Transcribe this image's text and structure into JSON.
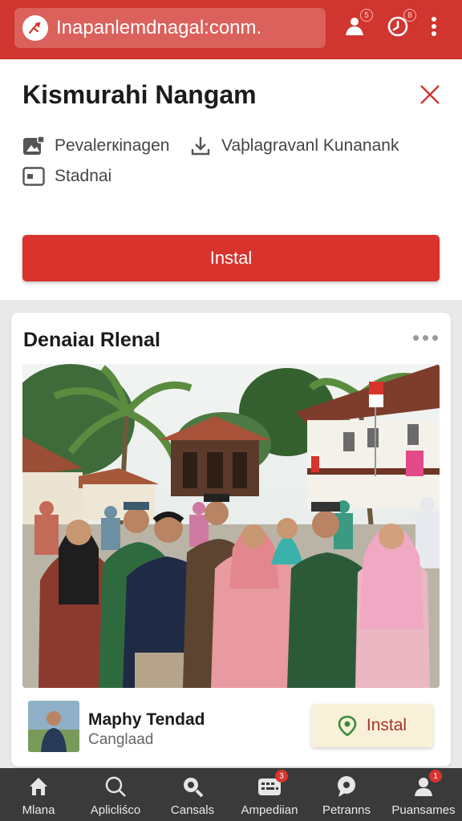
{
  "browser": {
    "url": "Inapanlemdnagal:conm.",
    "badges": {
      "downloads": "5",
      "history": "8"
    }
  },
  "app": {
    "title": "Kismurahi Nangam",
    "meta": [
      {
        "icon": "image-gallery-icon",
        "label": "Pevalerкinagen"
      },
      {
        "icon": "download-icon",
        "label": "Vaþlagravanl Kunanank"
      },
      {
        "icon": "screen-icon",
        "label": "Stadnai"
      }
    ],
    "install_label": "Instal"
  },
  "post": {
    "title": "Denaiaı Rlenal",
    "author_name": "Maphy Tendad",
    "author_sub": "Canglaad",
    "install_label": "Instal"
  },
  "nav": [
    {
      "label": "Mlana",
      "icon": "home-icon"
    },
    {
      "label": "Aplicliśco",
      "icon": "search-icon"
    },
    {
      "label": "Cansals",
      "icon": "zoom-icon"
    },
    {
      "label": "Ampediian",
      "icon": "keyboard-icon",
      "badge": "3"
    },
    {
      "label": "Petranns",
      "icon": "chat-icon"
    },
    {
      "label": "Puansames",
      "icon": "profile-icon",
      "badge": "1"
    }
  ],
  "colors": {
    "brand_red": "#d0352f",
    "install_small_bg": "#f8f0d8",
    "nav_bg": "#3a3a3a"
  }
}
